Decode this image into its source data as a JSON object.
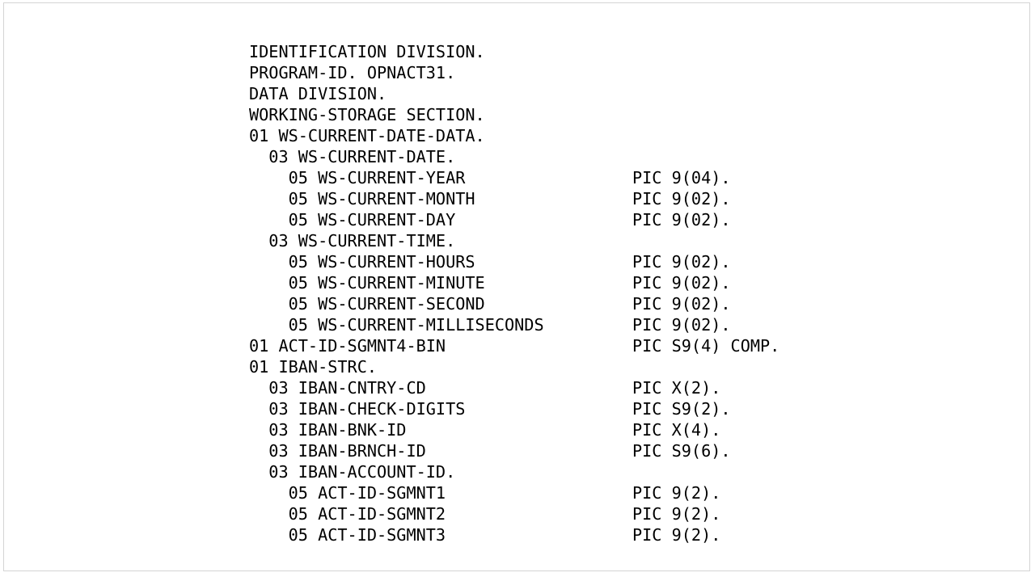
{
  "page": {
    "background_color": "#ffffff",
    "border_color": "#d4d4d4",
    "text_color": "#000000",
    "language": "COBOL",
    "program_name": "OPNACT31"
  },
  "code": {
    "lines": [
      "IDENTIFICATION DIVISION.",
      "PROGRAM-ID. OPNACT31.",
      "DATA DIVISION.",
      "WORKING-STORAGE SECTION.",
      "01 WS-CURRENT-DATE-DATA.",
      "  03 WS-CURRENT-DATE.",
      "    05 WS-CURRENT-YEAR                 PIC 9(04).",
      "    05 WS-CURRENT-MONTH                PIC 9(02).",
      "    05 WS-CURRENT-DAY                  PIC 9(02).",
      "  03 WS-CURRENT-TIME.",
      "    05 WS-CURRENT-HOURS                PIC 9(02).",
      "    05 WS-CURRENT-MINUTE               PIC 9(02).",
      "    05 WS-CURRENT-SECOND               PIC 9(02).",
      "    05 WS-CURRENT-MILLISECONDS         PIC 9(02).",
      "01 ACT-ID-SGMNT4-BIN                   PIC S9(4) COMP.",
      "01 IBAN-STRC.",
      "  03 IBAN-CNTRY-CD                     PIC X(2).",
      "  03 IBAN-CHECK-DIGITS                 PIC S9(2).",
      "  03 IBAN-BNK-ID                       PIC X(4).",
      "  03 IBAN-BRNCH-ID                     PIC S9(6).",
      "  03 IBAN-ACCOUNT-ID.",
      "    05 ACT-ID-SGMNT1                   PIC 9(2).",
      "    05 ACT-ID-SGMNT2                   PIC 9(2).",
      "    05 ACT-ID-SGMNT3                   PIC 9(2)."
    ]
  }
}
